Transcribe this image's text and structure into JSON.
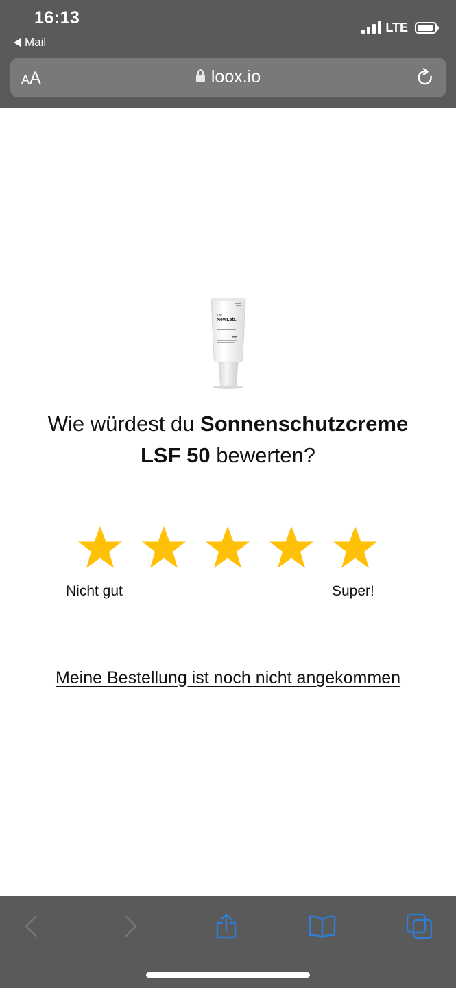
{
  "status_bar": {
    "time": "16:13",
    "back_app": "Mail",
    "network": "LTE"
  },
  "url_bar": {
    "text_size_small": "A",
    "text_size_large": "A",
    "domain": "loox.io"
  },
  "review": {
    "question_prefix": "Wie würdest du ",
    "product_name_line1": "Sonnenschutzcreme",
    "product_name_line2": "LSF 50",
    "question_suffix": " bewerten?",
    "rating_low_label": "Nicht gut",
    "rating_high_label": "Super!",
    "not_arrived_link": "Meine Bestellung ist noch nicht angekommen",
    "star_count": 5,
    "star_color": "#FFC107"
  },
  "product_image": {
    "brand_small": "The",
    "brand": "NewLab."
  },
  "toolbar": {
    "accent_color": "#2f7dd6",
    "disabled_color": "#777777"
  }
}
